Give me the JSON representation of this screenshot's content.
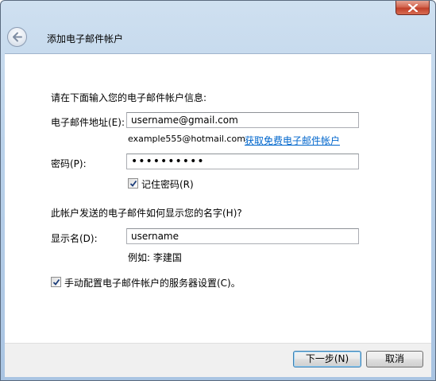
{
  "window": {
    "title": "添加电子邮件帐户"
  },
  "form": {
    "intro": "请在下面输入您的电子邮件帐户信息:",
    "email_label": "电子邮件地址(E):",
    "email_value": "username@gmail.com",
    "email_example": "example555@hotmail.com",
    "free_account_link": "获取免费电子邮件帐户",
    "password_label": "密码(P):",
    "password_value": "••••••••••",
    "remember_password_label": "记住密码(R)",
    "remember_password_checked": true,
    "display_question": "此帐户发送的电子邮件如何显示您的名字(H)?",
    "display_name_label": "显示名(D):",
    "display_name_value": "username",
    "display_name_example": "例如: 李建国",
    "manual_config_label": "手动配置电子邮件帐户的服务器设置(C)。",
    "manual_config_checked": true
  },
  "footer": {
    "next_label": "下一步(N)",
    "cancel_label": "取消"
  },
  "icons": {
    "close": "close-icon",
    "back": "back-arrow-icon",
    "check": "checkmark-icon"
  },
  "colors": {
    "link": "#0066cc",
    "close_button": "#c0402a",
    "chrome": "#b9d1ea"
  }
}
